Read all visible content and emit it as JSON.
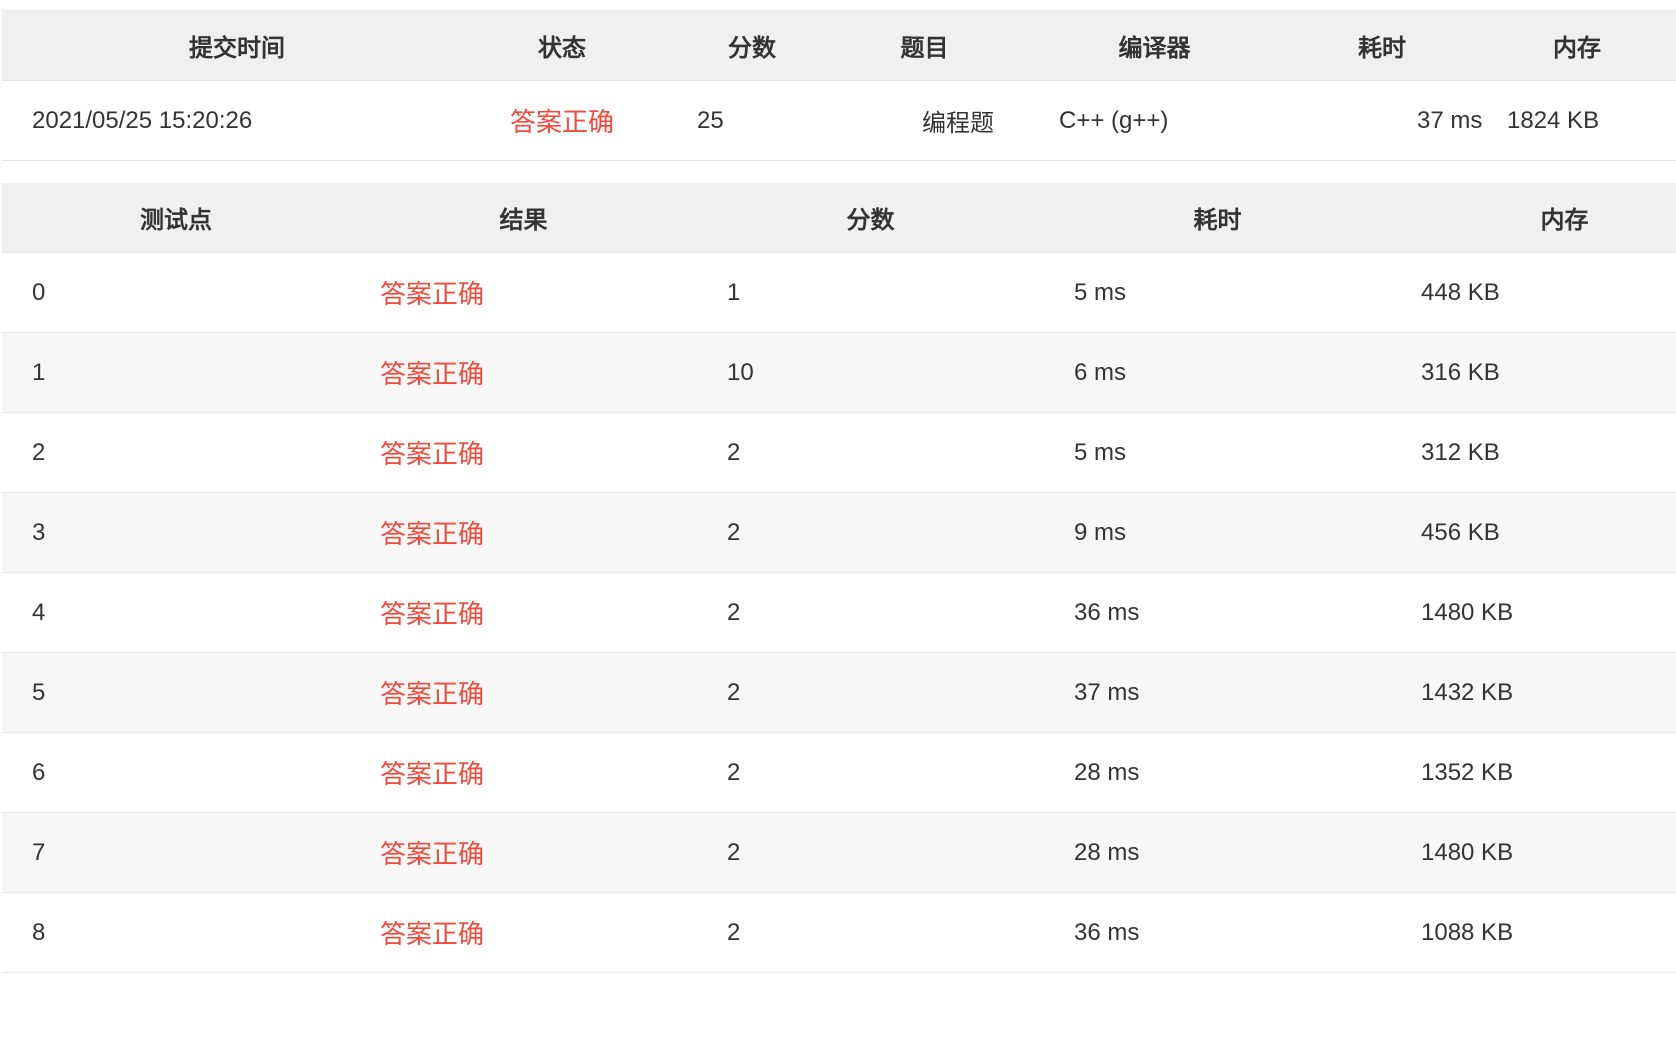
{
  "submission": {
    "headers": {
      "time": "提交时间",
      "status": "状态",
      "score": "分数",
      "problem": "题目",
      "compiler": "编译器",
      "elapsed": "耗时",
      "memory": "内存"
    },
    "row": {
      "time": "2021/05/25 15:20:26",
      "status": "答案正确",
      "score": "25",
      "problem": "编程题",
      "compiler": "C++ (g++)",
      "elapsed": "37 ms",
      "memory": "1824 KB"
    }
  },
  "testcases": {
    "headers": {
      "case": "测试点",
      "result": "结果",
      "score": "分数",
      "elapsed": "耗时",
      "memory": "内存"
    },
    "rows": [
      {
        "case": "0",
        "result": "答案正确",
        "score": "1",
        "elapsed": "5 ms",
        "memory": "448 KB"
      },
      {
        "case": "1",
        "result": "答案正确",
        "score": "10",
        "elapsed": "6 ms",
        "memory": "316 KB"
      },
      {
        "case": "2",
        "result": "答案正确",
        "score": "2",
        "elapsed": "5 ms",
        "memory": "312 KB"
      },
      {
        "case": "3",
        "result": "答案正确",
        "score": "2",
        "elapsed": "9 ms",
        "memory": "456 KB"
      },
      {
        "case": "4",
        "result": "答案正确",
        "score": "2",
        "elapsed": "36 ms",
        "memory": "1480 KB"
      },
      {
        "case": "5",
        "result": "答案正确",
        "score": "2",
        "elapsed": "37 ms",
        "memory": "1432 KB"
      },
      {
        "case": "6",
        "result": "答案正确",
        "score": "2",
        "elapsed": "28 ms",
        "memory": "1352 KB"
      },
      {
        "case": "7",
        "result": "答案正确",
        "score": "2",
        "elapsed": "28 ms",
        "memory": "1480 KB"
      },
      {
        "case": "8",
        "result": "答案正确",
        "score": "2",
        "elapsed": "36 ms",
        "memory": "1088 KB"
      }
    ]
  },
  "colors": {
    "accepted": "#f04a3b",
    "header_bg": "#f0f0f0",
    "stripe_bg": "#f7f7f7",
    "text": "#333333"
  }
}
